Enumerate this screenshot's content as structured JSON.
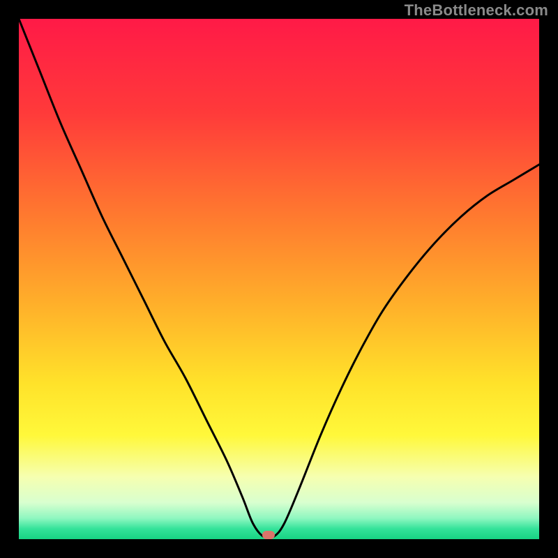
{
  "watermark": "TheBottleneck.com",
  "marker": {
    "color": "#d9746a",
    "x_pct": 48.0,
    "y_pct": 99.2
  },
  "gradient_stops": [
    {
      "pct": 0,
      "color": "#ff1a47"
    },
    {
      "pct": 18,
      "color": "#ff3a3a"
    },
    {
      "pct": 38,
      "color": "#ff7a2f"
    },
    {
      "pct": 55,
      "color": "#ffb02a"
    },
    {
      "pct": 70,
      "color": "#ffe22a"
    },
    {
      "pct": 80,
      "color": "#fff83a"
    },
    {
      "pct": 88,
      "color": "#f6ffb0"
    },
    {
      "pct": 93,
      "color": "#d8ffcf"
    },
    {
      "pct": 96,
      "color": "#8ef7c0"
    },
    {
      "pct": 98,
      "color": "#34e39a"
    },
    {
      "pct": 100,
      "color": "#17d483"
    }
  ],
  "chart_data": {
    "type": "line",
    "title": "",
    "xlabel": "",
    "ylabel": "",
    "xlim": [
      0,
      100
    ],
    "ylim": [
      0,
      100
    ],
    "series": [
      {
        "name": "curve",
        "x": [
          0,
          4,
          8,
          12,
          16,
          20,
          24,
          28,
          32,
          36,
          40,
          43,
          45,
          47,
          49,
          51,
          54,
          58,
          62,
          66,
          70,
          75,
          80,
          85,
          90,
          95,
          100
        ],
        "y": [
          100,
          90,
          80,
          71,
          62,
          54,
          46,
          38,
          31,
          23,
          15,
          8,
          3,
          0.5,
          0.5,
          3,
          10,
          20,
          29,
          37,
          44,
          51,
          57,
          62,
          66,
          69,
          72
        ]
      }
    ],
    "marker_point": {
      "x": 48,
      "y": 0.8
    }
  }
}
